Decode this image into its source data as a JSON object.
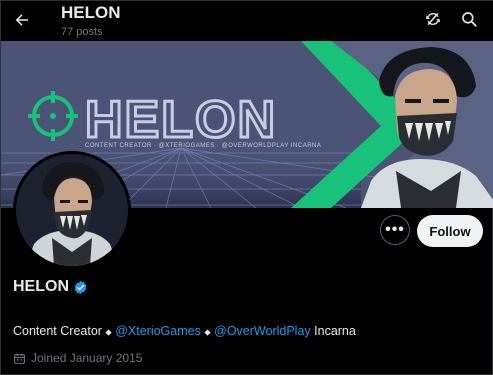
{
  "header": {
    "title": "HELON",
    "post_count": "77 posts"
  },
  "banner": {
    "logo_text": "HELON",
    "tagline": "CONTENT CREATOR · @XTERIOGAMES · @OVERWORLDPLAY INCARNA",
    "colors": {
      "background": "#4b5376",
      "accent": "#18c27a"
    }
  },
  "profile": {
    "name": "HELON",
    "verified": true,
    "bio": {
      "prefix": "Content Creator",
      "sep1": "⬥",
      "mention1": "@XterioGames",
      "sep2": "⬥",
      "mention2": "@OverWorldPlay",
      "suffix": "Incarna"
    },
    "joined": "Joined January 2015"
  },
  "actions": {
    "more_label": "•••",
    "follow_label": "Follow"
  },
  "icons": {
    "back": "arrow-left-icon",
    "sync": "sync-icon",
    "search": "search-icon",
    "verified": "verified-badge-icon",
    "calendar": "calendar-icon"
  },
  "colors": {
    "link": "#1d9bf0",
    "secondary_text": "#71767b",
    "verified": "#1d9bf0"
  }
}
